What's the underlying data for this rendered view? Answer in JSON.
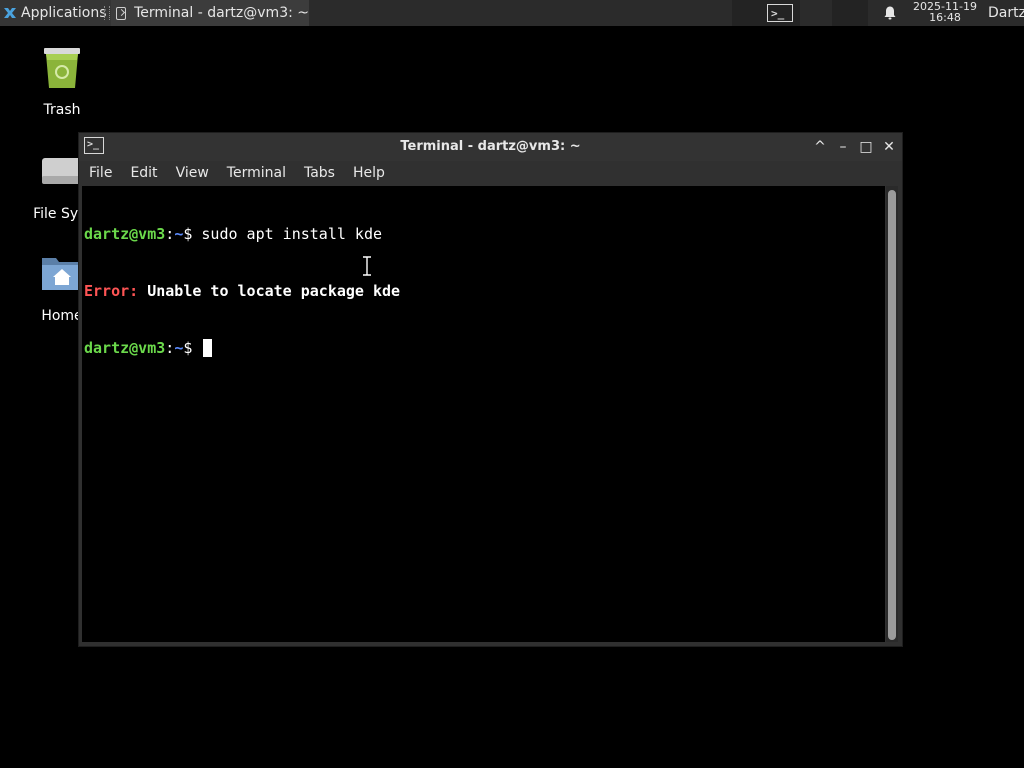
{
  "panel": {
    "applications_label": "Applications",
    "task_title": "Terminal - dartz@vm3: ~",
    "clock_date": "2025-11-19",
    "clock_time": "16:48",
    "user": "Dartz"
  },
  "desktop": {
    "icons": [
      {
        "label": "Trash"
      },
      {
        "label": "File Syst"
      },
      {
        "label": "Home"
      }
    ]
  },
  "window": {
    "title": "Terminal - dartz@vm3: ~",
    "menu": [
      "File",
      "Edit",
      "View",
      "Terminal",
      "Tabs",
      "Help"
    ],
    "controls": {
      "restore": "^",
      "minimize": "–",
      "maximize": "□",
      "close": "✕"
    }
  },
  "terminal": {
    "lines": [
      {
        "user_host": "dartz@vm3",
        "sep": ":",
        "path": "~",
        "prompt": "$ ",
        "command": "sudo apt install kde"
      },
      {
        "error_label": "Error:",
        "message": " Unable to locate package kde"
      },
      {
        "user_host": "dartz@vm3",
        "sep": ":",
        "path": "~",
        "prompt": "$ ",
        "command": ""
      }
    ]
  },
  "colors": {
    "prompt_user": "#6bd94b",
    "prompt_path": "#5c8cff",
    "error": "#ff5555",
    "background": "#000000"
  }
}
